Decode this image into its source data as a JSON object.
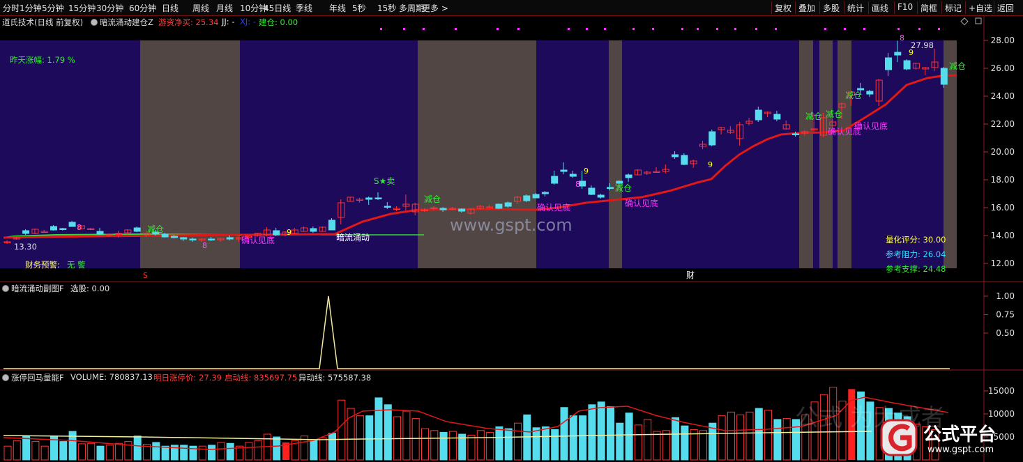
{
  "toolbar": {
    "left_items": [
      "分时",
      "1分钟",
      "5分钟",
      "15分钟",
      "30分钟",
      "60分钟",
      "日线",
      "周线",
      "月线",
      "10分钟",
      "45日线",
      "季线",
      "年线",
      "5秒",
      "15秒",
      "多周期",
      "更多 >"
    ],
    "right_items": [
      "复权",
      "叠加",
      "多股",
      "统计",
      "画线",
      "F10",
      "简框",
      "标记",
      "+自选",
      "返回"
    ]
  },
  "main_panel": {
    "stock_name": "道氏技术(日线 前复权)",
    "indicator_name": "暗流涌动建仓Z",
    "hot_money_label": "游资净买: 25.34",
    "jj_label": "JJ: -",
    "xj_label": "XJ: -",
    "build_label": "建仓: 0.00",
    "yesterday_change": "昨天涨幅: 1.79 %",
    "finance_warning_label": "财务预警:",
    "finance_warning_value": "无 警",
    "quant_score": "量化评分: 30.00",
    "resistance": "参考阻力: 26.04",
    "support": "参考支撑: 24.48",
    "low_marker": "13.30",
    "high_marker": "27.98",
    "watermark": "www.gspt.com",
    "annotations": {
      "reduce": "减仓",
      "confirm_bottom": "确认见底",
      "dark_flow": "暗流涌动",
      "sell": "S★卖",
      "nine": "9",
      "eight": "8",
      "s_mark": "S",
      "cai": "财"
    },
    "y_ticks": [
      "28.00",
      "26.00",
      "24.00",
      "22.00",
      "20.00",
      "18.00",
      "16.00",
      "14.00",
      "12.00"
    ]
  },
  "sub_panel": {
    "title": "暗流涌动副图F",
    "select_label": "选股: 0.00",
    "y_ticks": [
      "1.00",
      "0.75",
      "0.50"
    ]
  },
  "volume_panel": {
    "title": "涨停回马量能F",
    "volume_label": "VOLUME: 780837.13",
    "limit_price_label": "明日涨停价: 27.39",
    "start_line_label": "启动线: 835697.75",
    "abnormal_line_label": "异动线: 575587.38",
    "y_ticks": [
      "15000",
      "10000",
      "5000"
    ],
    "watermark_text": "公式平台",
    "watermark_url": "www.gspt.com",
    "bg_watermark": "公式 为大成者"
  },
  "chart_data": {
    "type": "candlestick",
    "y_range": [
      12,
      28.5
    ],
    "candles": [
      [
        13.55,
        13.65,
        13.4,
        13.55
      ],
      [
        13.75,
        13.95,
        13.7,
        13.85
      ],
      [
        14.35,
        14.45,
        14.05,
        14.15
      ],
      [
        14.15,
        14.5,
        14.1,
        14.45
      ],
      [
        14.25,
        14.4,
        14.2,
        14.3
      ],
      [
        14.65,
        14.75,
        14.35,
        14.4
      ],
      [
        14.5,
        14.55,
        14.35,
        14.45
      ],
      [
        14.95,
        15.05,
        14.65,
        14.65
      ],
      [
        14.5,
        14.75,
        14.45,
        14.7
      ],
      [
        14.5,
        14.55,
        14.4,
        14.5
      ],
      [
        14.3,
        14.55,
        14.05,
        14.1
      ],
      [
        14.05,
        14.15,
        13.95,
        14.1
      ],
      [
        14.1,
        14.35,
        13.85,
        14.15
      ],
      [
        14.2,
        14.45,
        14.05,
        14.4
      ],
      [
        14.55,
        14.65,
        14.25,
        14.3
      ],
      [
        14.05,
        14.35,
        13.9,
        14.15
      ],
      [
        14.25,
        14.4,
        14.0,
        14.1
      ],
      [
        14.1,
        14.2,
        13.85,
        13.9
      ],
      [
        13.95,
        14.05,
        13.8,
        13.85
      ],
      [
        13.85,
        13.9,
        13.6,
        13.75
      ],
      [
        13.75,
        13.85,
        13.55,
        13.7
      ],
      [
        13.7,
        13.8,
        13.55,
        13.75
      ],
      [
        13.75,
        13.9,
        13.6,
        13.7
      ],
      [
        13.7,
        13.85,
        13.55,
        13.8
      ],
      [
        13.85,
        14.0,
        13.65,
        13.75
      ],
      [
        13.75,
        13.9,
        13.55,
        13.85
      ],
      [
        13.9,
        14.0,
        13.85,
        13.95
      ],
      [
        14.0,
        14.2,
        13.9,
        14.15
      ],
      [
        14.05,
        14.6,
        13.95,
        14.4
      ],
      [
        14.35,
        14.55,
        13.95,
        14.05
      ],
      [
        14.05,
        14.3,
        13.95,
        14.25
      ],
      [
        14.15,
        14.55,
        14.1,
        14.4
      ],
      [
        14.3,
        14.65,
        14.3,
        14.55
      ],
      [
        14.5,
        14.65,
        14.2,
        14.3
      ],
      [
        14.3,
        14.65,
        14.3,
        14.6
      ],
      [
        15.1,
        15.25,
        14.4,
        14.4
      ],
      [
        15.3,
        16.6,
        14.8,
        16.35
      ],
      [
        16.45,
        16.75,
        16.45,
        16.75
      ],
      [
        16.55,
        16.7,
        16.35,
        16.6
      ],
      [
        16.7,
        16.8,
        16.2,
        16.6
      ],
      [
        16.7,
        17.1,
        16.55,
        16.65
      ],
      [
        16.1,
        16.4,
        15.9,
        16.05
      ],
      [
        15.95,
        16.1,
        15.75,
        15.95
      ],
      [
        16.1,
        16.95,
        15.8,
        16.25
      ],
      [
        15.7,
        16.35,
        15.45,
        16.25
      ],
      [
        15.8,
        15.95,
        15.7,
        15.85
      ],
      [
        15.95,
        16.1,
        15.8,
        16.0
      ],
      [
        15.95,
        16.05,
        15.7,
        15.85
      ],
      [
        15.95,
        16.05,
        15.8,
        15.95
      ],
      [
        15.9,
        15.95,
        15.65,
        15.75
      ],
      [
        15.6,
        15.95,
        15.5,
        15.9
      ],
      [
        15.95,
        16.2,
        15.85,
        16.1
      ],
      [
        16.05,
        16.2,
        15.95,
        16.05
      ],
      [
        16.25,
        16.3,
        15.9,
        15.95
      ],
      [
        16.35,
        16.45,
        16.0,
        16.1
      ],
      [
        16.45,
        16.85,
        16.25,
        16.75
      ],
      [
        16.85,
        16.95,
        16.4,
        16.5
      ],
      [
        16.95,
        17.05,
        16.7,
        16.7
      ],
      [
        17.1,
        17.2,
        16.8,
        17.0
      ],
      [
        18.25,
        18.65,
        17.65,
        17.75
      ],
      [
        18.7,
        19.25,
        18.4,
        18.6
      ],
      [
        18.4,
        18.65,
        18.15,
        18.25
      ],
      [
        17.9,
        18.65,
        17.35,
        17.55
      ],
      [
        17.4,
        17.6,
        16.9,
        16.95
      ],
      [
        16.9,
        17.0,
        16.65,
        16.75
      ],
      [
        17.45,
        17.75,
        17.25,
        17.4
      ],
      [
        17.9,
        17.95,
        17.45,
        17.75
      ],
      [
        18.35,
        18.45,
        17.85,
        18.15
      ],
      [
        18.35,
        18.75,
        18.35,
        18.7
      ],
      [
        18.45,
        18.65,
        18.35,
        18.55
      ],
      [
        18.55,
        18.9,
        18.5,
        18.6
      ],
      [
        18.6,
        19.1,
        18.45,
        18.75
      ],
      [
        19.8,
        20.05,
        19.5,
        19.65
      ],
      [
        19.75,
        19.9,
        19.05,
        19.1
      ],
      [
        19.15,
        19.45,
        18.85,
        19.35
      ],
      [
        20.4,
        20.8,
        20.2,
        20.55
      ],
      [
        21.45,
        21.6,
        20.4,
        20.5
      ],
      [
        21.6,
        21.8,
        21.25,
        21.75
      ],
      [
        21.4,
        21.85,
        21.3,
        21.55
      ],
      [
        20.95,
        22.15,
        20.45,
        21.95
      ],
      [
        22.05,
        22.45,
        21.9,
        22.2
      ],
      [
        23.0,
        23.25,
        22.15,
        22.3
      ],
      [
        22.75,
        22.9,
        22.5,
        22.85
      ],
      [
        22.7,
        22.95,
        22.2,
        22.35
      ],
      [
        21.65,
        22.25,
        21.6,
        21.95
      ],
      [
        21.3,
        21.45,
        21.1,
        21.25
      ],
      [
        21.35,
        21.55,
        21.15,
        21.45
      ],
      [
        21.6,
        22.75,
        21.45,
        21.65
      ],
      [
        21.2,
        22.8,
        21.05,
        22.45
      ],
      [
        21.9,
        22.35,
        21.45,
        22.15
      ],
      [
        23.2,
        23.55,
        22.35,
        23.45
      ],
      [
        24.05,
        24.4,
        23.3,
        24.3
      ],
      [
        24.55,
        24.95,
        24.1,
        24.45
      ],
      [
        24.35,
        24.45,
        23.95,
        24.15
      ],
      [
        23.65,
        25.25,
        23.3,
        25.15
      ],
      [
        26.75,
        27.1,
        25.45,
        25.9
      ],
      [
        27.15,
        27.98,
        26.45,
        26.95
      ],
      [
        26.55,
        26.65,
        25.85,
        25.95
      ],
      [
        26.0,
        26.4,
        25.9,
        26.35
      ],
      [
        25.95,
        26.1,
        25.5,
        26.05
      ],
      [
        26.05,
        27.4,
        25.8,
        26.45
      ],
      [
        26.0,
        26.1,
        24.6,
        24.85
      ]
    ]
  }
}
